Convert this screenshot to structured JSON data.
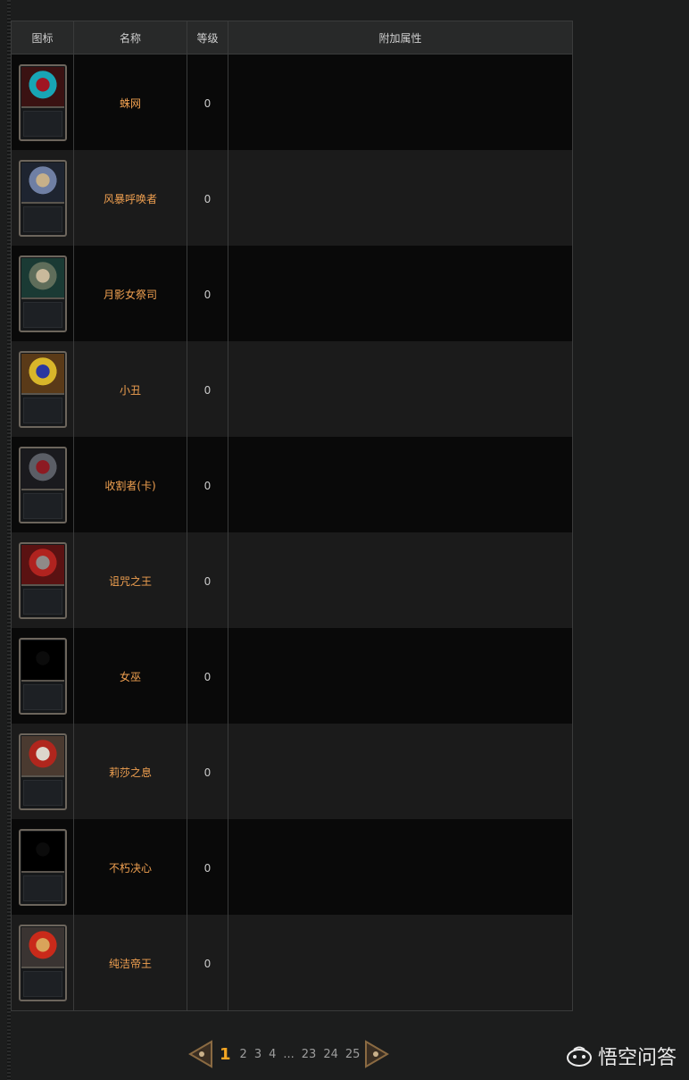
{
  "table": {
    "headers": {
      "icon": "图标",
      "name": "名称",
      "level": "等级",
      "attr": "附加属性"
    },
    "rows": [
      {
        "name": "蛛网",
        "level": "0",
        "attr": "",
        "art": [
          "#3a1212",
          "#18a5b5",
          "#a01622"
        ]
      },
      {
        "name": "风暴呼唤者",
        "level": "0",
        "attr": "",
        "art": [
          "#1e2430",
          "#6f7fa4",
          "#c7b089"
        ]
      },
      {
        "name": "月影女祭司",
        "level": "0",
        "attr": "",
        "art": [
          "#1a3a34",
          "#5f6d5a",
          "#c9b99b"
        ]
      },
      {
        "name": "小丑",
        "level": "0",
        "attr": "",
        "art": [
          "#5a3a18",
          "#d8b62a",
          "#2a37a0"
        ]
      },
      {
        "name": "收割者(卡)",
        "level": "0",
        "attr": "",
        "art": [
          "#1a1a1e",
          "#5b5e66",
          "#8d1a22"
        ]
      },
      {
        "name": "诅咒之王",
        "level": "0",
        "attr": "",
        "art": [
          "#5a1212",
          "#b0231f",
          "#8f8a88"
        ]
      },
      {
        "name": "女巫",
        "level": "0",
        "attr": "",
        "art": [
          "#000000",
          "#000000",
          "#0b0b0b"
        ]
      },
      {
        "name": "莉莎之息",
        "level": "0",
        "attr": "",
        "art": [
          "#4a3a30",
          "#b0261d",
          "#dcd6cc"
        ]
      },
      {
        "name": "不朽决心",
        "level": "0",
        "attr": "",
        "art": [
          "#000000",
          "#000000",
          "#0b0b0b"
        ]
      },
      {
        "name": "纯洁帝王",
        "level": "0",
        "attr": "",
        "art": [
          "#3a3432",
          "#c92a1a",
          "#d9a35a"
        ]
      }
    ]
  },
  "pagination": {
    "current": "1",
    "pages": [
      "2",
      "3",
      "4"
    ],
    "ellipsis": "...",
    "tail_pages": [
      "23",
      "24",
      "25"
    ]
  },
  "watermark": {
    "text": "悟空问答"
  },
  "colors": {
    "accent": "#f0a050",
    "page_current": "#f5a623"
  }
}
